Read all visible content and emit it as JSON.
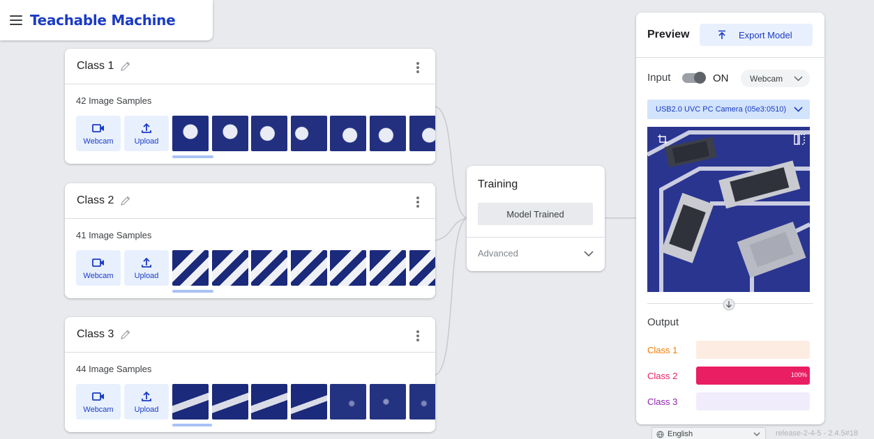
{
  "app": {
    "title": "Teachable Machine"
  },
  "classes": [
    {
      "name": "Class 1",
      "samples": "42 Image Samples",
      "webcam_label": "Webcam",
      "upload_label": "Upload"
    },
    {
      "name": "Class 2",
      "samples": "41 Image Samples",
      "webcam_label": "Webcam",
      "upload_label": "Upload"
    },
    {
      "name": "Class 3",
      "samples": "44 Image Samples",
      "webcam_label": "Webcam",
      "upload_label": "Upload"
    }
  ],
  "training": {
    "title": "Training",
    "button": "Model Trained",
    "advanced": "Advanced"
  },
  "preview": {
    "title": "Preview",
    "export_label": "Export Model",
    "input_label": "Input",
    "toggle_state": "ON",
    "source": "Webcam",
    "camera": "USB2.0 UVC PC Camera (05e3:0510)",
    "output_label": "Output",
    "outputs": [
      {
        "name": "Class 1",
        "color": "#f57c00",
        "bg": "#fdece2",
        "fill": 0,
        "pct": ""
      },
      {
        "name": "Class 2",
        "color": "#e91e63",
        "bg": "#fce4ec",
        "fill": 1.0,
        "pct": "100%"
      },
      {
        "name": "Class 3",
        "color": "#8e24aa",
        "bg": "#f1ecfb",
        "fill": 0,
        "pct": ""
      }
    ]
  },
  "footer": {
    "language": "English",
    "release": "release-2-4-5 - 2.4.5#18"
  },
  "colors": {
    "brand_blue": "#1a3bc4",
    "button_bg": "#e8f0fe",
    "page_bg": "#e8eaed"
  }
}
